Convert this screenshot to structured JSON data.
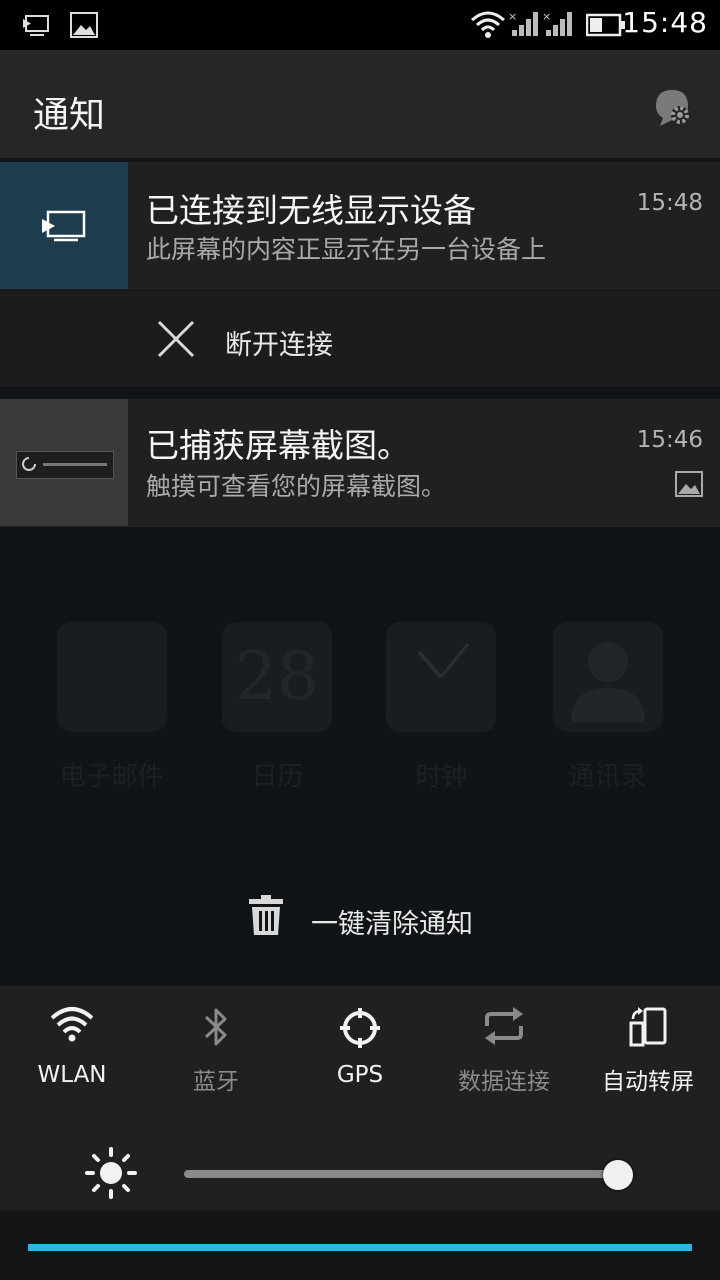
{
  "status_bar": {
    "time": "15:48",
    "icons": [
      "cast-icon",
      "image-icon",
      "wifi-icon",
      "signal-icon",
      "signal-icon",
      "battery-icon"
    ]
  },
  "header": {
    "title": "通知",
    "settings_icon": "chat-gear-icon"
  },
  "notifications": [
    {
      "title": "已连接到无线显示设备",
      "text": "此屏幕的内容正显示在另一台设备上",
      "time": "15:48",
      "icon": "cast-icon",
      "action": {
        "icon": "close-icon",
        "label": "断开连接"
      }
    },
    {
      "title": "已捕获屏幕截图。",
      "text": "触摸可查看您的屏幕截图。",
      "time": "15:46",
      "icon": "image-icon"
    }
  ],
  "background_apps": [
    {
      "label": "电子邮件"
    },
    {
      "label": "日历",
      "glyph": "28"
    },
    {
      "label": "时钟"
    },
    {
      "label": "通讯录"
    }
  ],
  "clear_all": {
    "label": "一键清除通知",
    "icon": "trash-icon"
  },
  "quick_settings": [
    {
      "label": "WLAN",
      "icon": "wifi-icon",
      "enabled": true
    },
    {
      "label": "蓝牙",
      "icon": "bluetooth-icon",
      "enabled": false
    },
    {
      "label": "GPS",
      "icon": "gps-icon",
      "enabled": true
    },
    {
      "label": "数据连接",
      "icon": "sync-icon",
      "enabled": false
    },
    {
      "label": "自动转屏",
      "icon": "rotate-icon",
      "enabled": true
    }
  ],
  "brightness": {
    "icon": "sun-icon",
    "level": 0.99
  },
  "colors": {
    "accent": "#2eb6e8",
    "cast_bg": "#1d3d4e"
  }
}
